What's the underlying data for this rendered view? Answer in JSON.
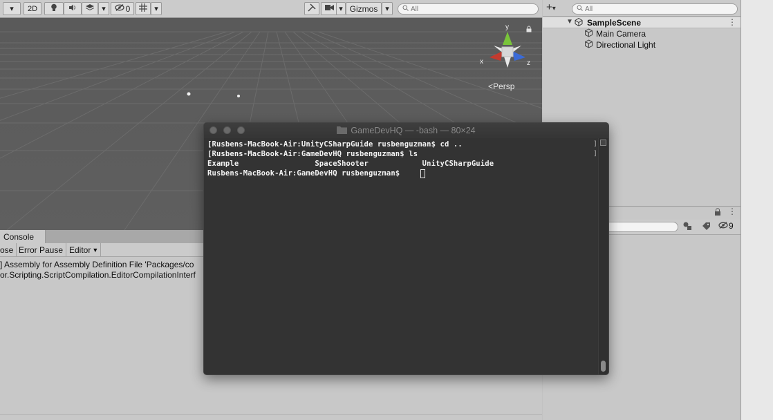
{
  "scene_toolbar": {
    "mode_2d": "2D",
    "hidden_count": "0",
    "gizmos": "Gizmos",
    "search_placeholder": "All"
  },
  "scene_view": {
    "axis_y": "y",
    "axis_x": "x",
    "axis_z": "z",
    "projection": "Persp"
  },
  "hierarchy": {
    "search_placeholder": "All",
    "scene_name": "SampleScene",
    "items": [
      "Main Camera",
      "Directional Light"
    ]
  },
  "inspector": {
    "layer_count": "9"
  },
  "console": {
    "tab_label": "Console",
    "clear_label": "ose",
    "error_pause": "Error Pause",
    "editor": "Editor",
    "logs": [
      "] Assembly for Assembly Definition File 'Packages/co",
      "or.Scripting.ScriptCompilation.EditorCompilationInterf"
    ]
  },
  "terminal": {
    "title": "GameDevHQ — -bash — 80×24",
    "lines": [
      "[Rusbens-MacBook-Air:UnityCSharpGuide rusbenguzman$ cd ..",
      "[Rusbens-MacBook-Air:GameDevHQ rusbenguzman$ ls",
      "Example                 SpaceShooter            UnityCSharpGuide",
      "Rusbens-MacBook-Air:GameDevHQ rusbenguzman$ "
    ]
  },
  "colors": {
    "gizmo_y": "#79c43a",
    "gizmo_x": "#c33a2e",
    "gizmo_z": "#3a6ad6",
    "scene_bg": "#5b5b5b",
    "terminal_bg": "#333333"
  }
}
